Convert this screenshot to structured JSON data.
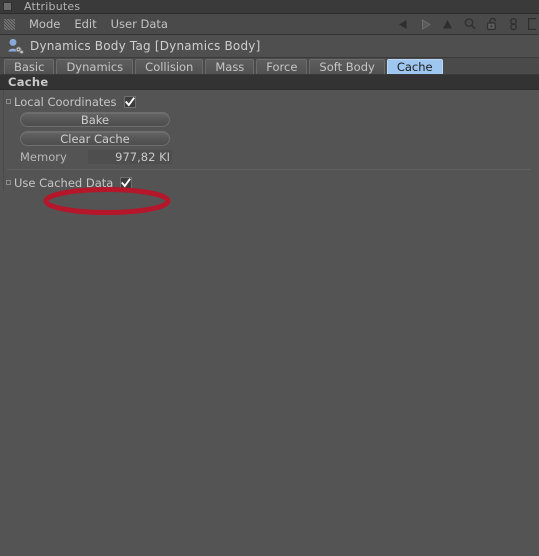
{
  "window": {
    "title": "Attributes",
    "titlebar_button_icon": "window-square-icon"
  },
  "menubar": {
    "grip_icon": "drag-grip-icon",
    "items": [
      {
        "label": "Mode"
      },
      {
        "label": "Edit"
      },
      {
        "label": "User Data"
      }
    ],
    "tool_icons": [
      {
        "name": "back-arrow-icon",
        "title": "Back"
      },
      {
        "name": "forward-arrow-icon",
        "title": "Forward"
      },
      {
        "name": "up-arrow-icon",
        "title": "Up one level"
      },
      {
        "name": "search-icon",
        "title": "Search"
      },
      {
        "name": "unlock-icon",
        "title": "Lock/Unlock"
      },
      {
        "name": "cross-link-icon",
        "title": "Cross Link"
      },
      {
        "name": "panel-icon",
        "title": "Panel"
      }
    ]
  },
  "object_header": {
    "icon": "dynamics-body-tag-icon",
    "title": "Dynamics Body Tag [Dynamics Body]"
  },
  "tabs": [
    {
      "label": "Basic",
      "active": false
    },
    {
      "label": "Dynamics",
      "active": false
    },
    {
      "label": "Collision",
      "active": false
    },
    {
      "label": "Mass",
      "active": false
    },
    {
      "label": "Force",
      "active": false
    },
    {
      "label": "Soft Body",
      "active": false
    },
    {
      "label": "Cache",
      "active": true
    }
  ],
  "cache_panel": {
    "group_title": "Cache",
    "local_coordinates": {
      "label": "Local Coordinates",
      "checked": true,
      "check_icon": "checkmark-icon",
      "bullet_icon": "tree-bullet-icon"
    },
    "bake_button": {
      "label": "Bake"
    },
    "clear_cache_button": {
      "label": "Clear Cache"
    },
    "memory": {
      "label": "Memory",
      "value": "977,82 KI"
    },
    "use_cached_data": {
      "label": "Use Cached Data",
      "checked": true,
      "check_icon": "checkmark-icon",
      "bullet_icon": "tree-bullet-icon"
    }
  },
  "annotation": {
    "shape": "ellipse",
    "target": "Bake",
    "color": "#b5162a"
  },
  "colors": {
    "panel_bg": "#545454",
    "titlebar_bg": "#3a3a3a",
    "menubar_bg": "#4a4a4a",
    "group_header_bg": "#333333",
    "active_tab_bg": "#9ec6ee",
    "annotation_red": "#b5162a"
  }
}
